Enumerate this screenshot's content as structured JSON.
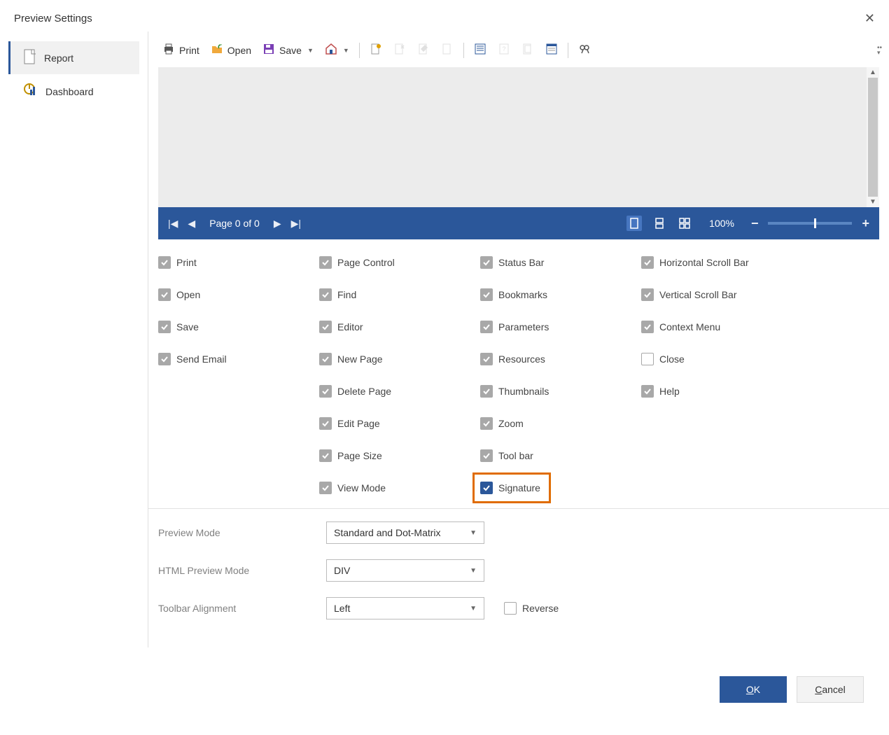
{
  "dialog": {
    "title": "Preview Settings"
  },
  "sidebar": {
    "items": [
      {
        "label": "Report",
        "selected": true
      },
      {
        "label": "Dashboard",
        "selected": false
      }
    ]
  },
  "toolbar": {
    "print": "Print",
    "open": "Open",
    "save": "Save"
  },
  "pager": {
    "page_text": "Page 0 of 0",
    "zoom_text": "100%"
  },
  "checkboxes": {
    "col1": [
      {
        "label": "Print",
        "checked": true
      },
      {
        "label": "Open",
        "checked": true
      },
      {
        "label": "Save",
        "checked": true
      },
      {
        "label": "Send Email",
        "checked": true
      }
    ],
    "col2": [
      {
        "label": "Page Control",
        "checked": true
      },
      {
        "label": "Find",
        "checked": true
      },
      {
        "label": "Editor",
        "checked": true
      },
      {
        "label": "New Page",
        "checked": true
      },
      {
        "label": "Delete Page",
        "checked": true
      },
      {
        "label": "Edit Page",
        "checked": true
      },
      {
        "label": "Page Size",
        "checked": true
      },
      {
        "label": "View Mode",
        "checked": true
      }
    ],
    "col3": [
      {
        "label": "Status Bar",
        "checked": true
      },
      {
        "label": "Bookmarks",
        "checked": true
      },
      {
        "label": "Parameters",
        "checked": true
      },
      {
        "label": "Resources",
        "checked": true
      },
      {
        "label": "Thumbnails",
        "checked": true
      },
      {
        "label": "Zoom",
        "checked": true
      },
      {
        "label": "Tool bar",
        "checked": true
      },
      {
        "label": "Signature",
        "checked": true,
        "highlight": true
      }
    ],
    "col4": [
      {
        "label": "Horizontal Scroll Bar",
        "checked": true
      },
      {
        "label": "Vertical Scroll Bar",
        "checked": true
      },
      {
        "label": "Context Menu",
        "checked": true
      },
      {
        "label": "Close",
        "checked": false
      },
      {
        "label": "Help",
        "checked": true
      }
    ]
  },
  "selects": {
    "preview_mode": {
      "label": "Preview Mode",
      "value": "Standard and Dot-Matrix"
    },
    "html_preview_mode": {
      "label": "HTML Preview Mode",
      "value": "DIV"
    },
    "toolbar_alignment": {
      "label": "Toolbar Alignment",
      "value": "Left"
    },
    "reverse_label": "Reverse"
  },
  "footer": {
    "ok": "OK",
    "cancel": "Cancel"
  }
}
